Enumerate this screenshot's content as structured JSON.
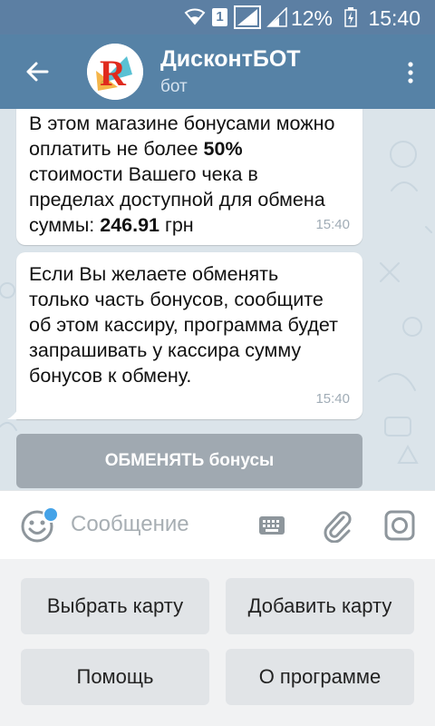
{
  "status_bar": {
    "sim_label": "1",
    "battery_text": "12%",
    "time": "15:40"
  },
  "header": {
    "title": "ДисконтБОТ",
    "subtitle": "бот",
    "avatar_text": "R"
  },
  "messages": [
    {
      "parts": [
        {
          "text": "В этом магазине бонусами можно оплатить не более ",
          "bold": false
        },
        {
          "text": "50%",
          "bold": true
        },
        {
          "text": " стоимости Вашего чека в пределах доступной для обмена суммы: ",
          "bold": false
        },
        {
          "text": "246.91",
          "bold": true
        },
        {
          "text": " грн",
          "bold": false
        }
      ],
      "time": "15:40"
    },
    {
      "parts": [
        {
          "text": "Если Вы желаете обменять только часть бонусов, сообщите об этом кассиру, программа будет запрашивать у кассира сумму бонусов к обмену.",
          "bold": false
        }
      ],
      "time": "15:40"
    }
  ],
  "inline_button": {
    "label": "ОБМЕНЯТЬ бонусы"
  },
  "input": {
    "placeholder": "Сообщение"
  },
  "keyboard": {
    "buttons": [
      {
        "label": "Выбрать карту"
      },
      {
        "label": "Добавить карту"
      },
      {
        "label": "Помощь"
      },
      {
        "label": "О программе"
      }
    ]
  },
  "colors": {
    "status_bar": "#5c7fa3",
    "app_bar": "#5682a6",
    "accent_dot": "#45a3e8"
  },
  "icons": [
    "wifi-icon",
    "signal-icon",
    "battery-icon",
    "back-arrow-icon",
    "more-vert-icon",
    "emoji-icon",
    "keyboard-icon",
    "paperclip-icon",
    "camera-icon"
  ]
}
